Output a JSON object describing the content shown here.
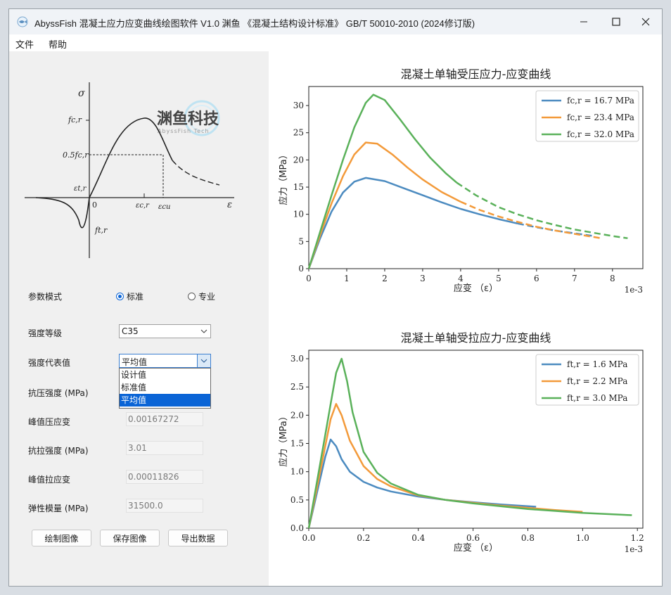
{
  "window": {
    "title": "AbyssFish 混凝土应力应变曲线绘图软件 V1.0 渊鱼 《混凝土结构设计标准》 GB/T 50010-2010 (2024修订版)",
    "controls": [
      "minimize-icon",
      "maximize-icon",
      "close-icon"
    ]
  },
  "menu": {
    "items": [
      "文件",
      "帮助"
    ]
  },
  "diagram": {
    "watermark": "渊鱼科技",
    "watermark_sub": "AbyssFish Tech",
    "labels": {
      "sigma": "σ",
      "fc": "fc,r",
      "half_fc": "0.5fc,r",
      "eps_t": "εt,r",
      "eps_c": "εc,r",
      "eps_cu": "εcu",
      "eps": "ε",
      "ft": "ft,r",
      "origin": "0"
    }
  },
  "form": {
    "mode_label": "参数模式",
    "mode_options": [
      {
        "label": "标准",
        "checked": true
      },
      {
        "label": "专业",
        "checked": false
      }
    ],
    "grade_label": "强度等级",
    "grade_value": "C35",
    "repr_label": "强度代表值",
    "repr_value": "平均值",
    "repr_options": [
      {
        "label": "设计值",
        "selected": false
      },
      {
        "label": "标准值",
        "selected": false
      },
      {
        "label": "平均值",
        "selected": true
      }
    ],
    "fields": [
      {
        "label": "抗压强度 (MPa)",
        "value": ""
      },
      {
        "label": "峰值压应变",
        "value": "0.00167272"
      },
      {
        "label": "抗拉强度 (MPa)",
        "value": "3.01"
      },
      {
        "label": "峰值拉应变",
        "value": "0.00011826"
      },
      {
        "label": "弹性模量 (MPa)",
        "value": "31500.0"
      }
    ],
    "buttons": {
      "plot": "绘制图像",
      "save": "保存图像",
      "export": "导出数据"
    }
  },
  "chart_data": [
    {
      "type": "line",
      "title": "混凝土单轴受压应力-应变曲线",
      "xlabel": "应变 （ε）",
      "ylabel": "应力（MPa）",
      "x_scale_label": "1e-3",
      "xlim": [
        0,
        8.8
      ],
      "ylim": [
        0,
        33.5
      ],
      "xticks": [
        "0",
        "1",
        "2",
        "3",
        "4",
        "5",
        "6",
        "7",
        "8"
      ],
      "yticks": [
        "0",
        "5",
        "10",
        "15",
        "20",
        "25",
        "30"
      ],
      "legend_position": "top-right",
      "ultimate_strain": [
        5.5,
        4.2,
        3.9
      ],
      "series": [
        {
          "name": "fc,r = 16.7 MPa",
          "color": "#4c8bc0",
          "x": [
            0,
            0.3,
            0.6,
            0.9,
            1.2,
            1.5,
            2.0,
            2.5,
            3.0,
            3.5,
            4.0,
            4.5,
            5.0,
            5.5,
            6.0,
            6.5,
            7.0,
            7.5
          ],
          "y": [
            0,
            5.6,
            10.5,
            14.0,
            16.0,
            16.7,
            16.1,
            14.8,
            13.5,
            12.2,
            11.0,
            10.0,
            9.1,
            8.3,
            7.6,
            7.0,
            6.5,
            6.0
          ]
        },
        {
          "name": "fc,r = 23.4 MPa",
          "color": "#f39a3a",
          "x": [
            0,
            0.3,
            0.6,
            0.9,
            1.2,
            1.5,
            1.8,
            2.2,
            2.6,
            3.0,
            3.5,
            4.0,
            4.5,
            5.0,
            5.5,
            6.0,
            6.5,
            7.0,
            7.7
          ],
          "y": [
            0,
            6.2,
            12.0,
            17.0,
            21.0,
            23.2,
            23.0,
            21.0,
            18.6,
            16.4,
            14.1,
            12.3,
            10.8,
            9.6,
            8.6,
            7.7,
            7.0,
            6.4,
            5.6
          ]
        },
        {
          "name": "fc,r = 32.0 MPa",
          "color": "#5ab15a",
          "x": [
            0,
            0.3,
            0.6,
            0.9,
            1.2,
            1.5,
            1.7,
            2.0,
            2.4,
            2.8,
            3.2,
            3.6,
            3.9,
            4.4,
            5.0,
            5.5,
            6.0,
            6.5,
            7.0,
            7.5,
            8.0,
            8.4
          ],
          "y": [
            0,
            6.8,
            13.5,
            20.0,
            26.0,
            30.5,
            32.0,
            31.0,
            27.5,
            23.8,
            20.4,
            17.6,
            15.8,
            13.5,
            11.3,
            10.0,
            8.9,
            8.0,
            7.2,
            6.6,
            6.0,
            5.6
          ]
        }
      ]
    },
    {
      "type": "line",
      "title": "混凝土单轴受拉应力-应变曲线",
      "xlabel": "应变 （ε）",
      "ylabel": "应力（MPa）",
      "x_scale_label": "1e-3",
      "xlim": [
        0,
        1.22
      ],
      "ylim": [
        0,
        3.15
      ],
      "xticks": [
        "0.0",
        "0.2",
        "0.4",
        "0.6",
        "0.8",
        "1.0",
        "1.2"
      ],
      "yticks": [
        "0.0",
        "0.5",
        "1.0",
        "1.5",
        "2.0",
        "2.5",
        "3.0"
      ],
      "legend_position": "top-right",
      "series": [
        {
          "name": "ft,r = 1.6 MPa",
          "color": "#4c8bc0",
          "x": [
            0,
            0.02,
            0.04,
            0.06,
            0.08,
            0.1,
            0.12,
            0.15,
            0.2,
            0.25,
            0.3,
            0.4,
            0.5,
            0.6,
            0.7,
            0.83
          ],
          "y": [
            0,
            0.42,
            0.84,
            1.26,
            1.57,
            1.45,
            1.22,
            1.0,
            0.82,
            0.72,
            0.65,
            0.56,
            0.5,
            0.46,
            0.42,
            0.38
          ]
        },
        {
          "name": "ft,r = 2.2 MPa",
          "color": "#f39a3a",
          "x": [
            0,
            0.02,
            0.04,
            0.06,
            0.08,
            0.1,
            0.12,
            0.15,
            0.2,
            0.25,
            0.3,
            0.4,
            0.5,
            0.6,
            0.7,
            0.8,
            0.9,
            1.0
          ],
          "y": [
            0,
            0.48,
            0.96,
            1.45,
            1.93,
            2.2,
            2.0,
            1.55,
            1.1,
            0.87,
            0.74,
            0.58,
            0.5,
            0.45,
            0.4,
            0.36,
            0.32,
            0.29
          ]
        },
        {
          "name": "ft,r = 3.0 MPa",
          "color": "#5ab15a",
          "x": [
            0,
            0.02,
            0.04,
            0.06,
            0.08,
            0.1,
            0.12,
            0.14,
            0.16,
            0.2,
            0.25,
            0.3,
            0.4,
            0.5,
            0.6,
            0.8,
            1.0,
            1.18
          ],
          "y": [
            0,
            0.55,
            1.1,
            1.65,
            2.2,
            2.75,
            3.0,
            2.6,
            2.05,
            1.35,
            0.98,
            0.79,
            0.59,
            0.5,
            0.44,
            0.34,
            0.27,
            0.23
          ]
        }
      ]
    }
  ]
}
